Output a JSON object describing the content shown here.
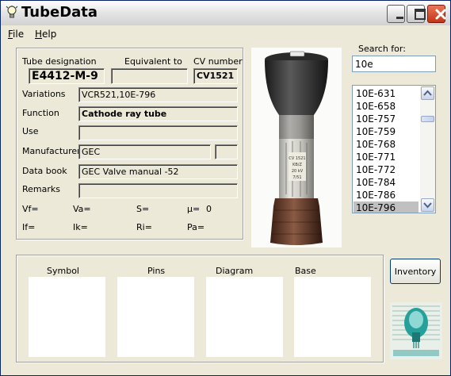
{
  "window": {
    "title": "TubeData",
    "colors": {
      "face": "#ece9d8",
      "selection": "#c0c0c0",
      "close": "#d24d2c"
    }
  },
  "icons": [
    "bulb-icon",
    "minimize-icon",
    "maximize-icon",
    "close-icon",
    "scroll-up-icon",
    "scroll-down-icon"
  ],
  "menu": {
    "file": "File",
    "help": "Help"
  },
  "info": {
    "designation_label": "Tube designation",
    "equivalent_label": "Equivalent to",
    "cv_label": "CV number",
    "designation": "E4412-M-9",
    "equivalent": "",
    "cv": "CV1521",
    "variations_label": "Variations",
    "variations": "VCR521,10E-796",
    "function_label": "Function",
    "function": "Cathode ray tube",
    "use_label": "Use",
    "use": "",
    "manufacturer_label": "Manufacturer",
    "manufacturer": "GEC",
    "manufacturer_code": "",
    "databook_label": "Data book",
    "databook": "GEC Valve manual -52",
    "remarks_label": "Remarks",
    "remarks": "",
    "vf": "Vf=",
    "va": "Va=",
    "s": "S=",
    "mu": "µ=",
    "mu_value": "0",
    "if": "If=",
    "ik": "Ik=",
    "ri": "Ri=",
    "pa": "Pa="
  },
  "photo": {
    "label_lines": [
      "CV 1521",
      "KB/Z",
      "20 kV",
      "7/51"
    ]
  },
  "search": {
    "label": "Search for:",
    "value": "10e"
  },
  "list": {
    "items": [
      "10E-631",
      "10E-658",
      "10E-757",
      "10E-759",
      "10E-768",
      "10E-771",
      "10E-772",
      "10E-784",
      "10E-786",
      "10E-796"
    ],
    "selected_index": 9
  },
  "images": {
    "symbol": "Symbol",
    "pins": "Pins",
    "diagram": "Diagram",
    "base": "Base"
  },
  "inventory_button": "Inventory"
}
